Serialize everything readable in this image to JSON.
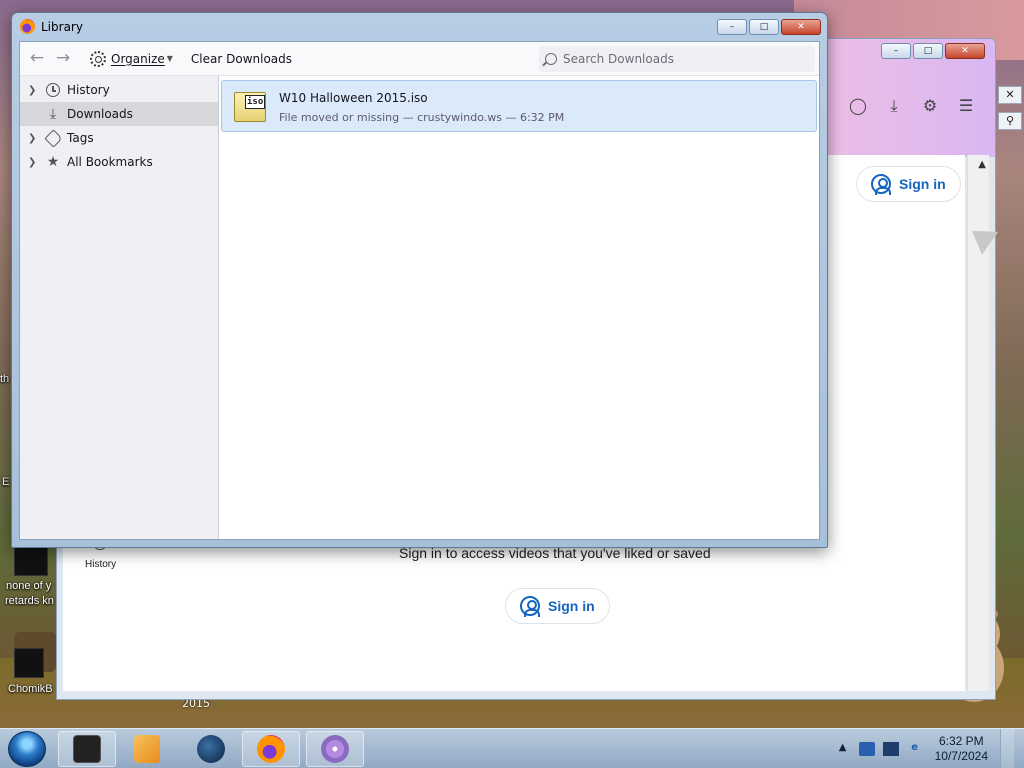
{
  "desktop": {
    "labels": [
      "none of y",
      "retards kn",
      "ChomikB"
    ],
    "year_label": "2015",
    "edge_letters": [
      "th",
      "E"
    ]
  },
  "background_window": {
    "sign_in_label": "Sign in",
    "sign_in_text": "Sign in to access videos that you've liked or saved",
    "history_label": "History",
    "caption_buttons": [
      "–",
      "□",
      "✕"
    ]
  },
  "library": {
    "title": "Library",
    "caption_buttons": {
      "minimize": "–",
      "maximize": "□",
      "close": "✕"
    },
    "toolbar": {
      "back": "←",
      "forward": "→",
      "organize_label": "Organize",
      "clear_downloads_label": "Clear Downloads",
      "search_placeholder": "Search Downloads"
    },
    "sidebar": {
      "items": [
        {
          "label": "History",
          "icon": "clock-icon",
          "expandable": true,
          "selected": false
        },
        {
          "label": "Downloads",
          "icon": "download-icon",
          "expandable": false,
          "selected": true
        },
        {
          "label": "Tags",
          "icon": "tag-icon",
          "expandable": true,
          "selected": false
        },
        {
          "label": "All Bookmarks",
          "icon": "star-icon",
          "expandable": true,
          "selected": false
        }
      ]
    },
    "downloads": [
      {
        "file_name": "W10 Halloween 2015.iso",
        "file_icon_label": "iso",
        "status": "File moved or missing — crustywindo.ws — 6:32 PM"
      }
    ]
  },
  "taskbar": {
    "clock_time": "6:32 PM",
    "clock_date": "10/7/2024",
    "tray_chevron": "▲"
  },
  "colors": {
    "selected_row": "#dbeafb",
    "sidebar_bg": "#f0f0f4",
    "link_blue": "#1565c0"
  }
}
